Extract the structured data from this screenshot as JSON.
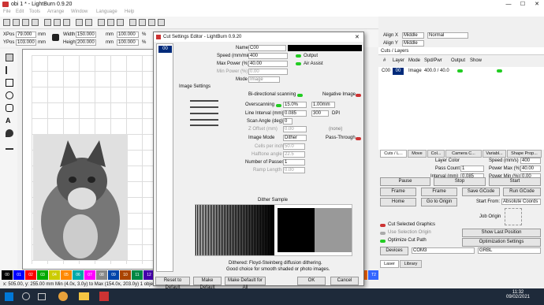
{
  "window": {
    "title": "obi 1 * - LightBurn 0.9.20"
  },
  "menu": [
    "File",
    "Edit",
    "Tools",
    "Arrange",
    "Window",
    "Language",
    "Help"
  ],
  "numbar": {
    "xpos_label": "XPos",
    "xpos": "79.000",
    "ypos_label": "YPos",
    "ypos": "103.000",
    "unit": "mm",
    "width_label": "Width",
    "width": "150.000",
    "height_label": "Height",
    "height": "200.000",
    "pct1": "100.000",
    "pct2": "100.000",
    "pct_sign": "%"
  },
  "top_right": {
    "align_x": "Align X",
    "middle": "Middle",
    "normal": "Normal",
    "align_y": "Align Y",
    "middle2": "Middle"
  },
  "dialog": {
    "title": "Cut Settings Editor - LightBurn 0.9.20",
    "layer_item": "00",
    "name_label": "Name",
    "name_value": "C00",
    "speed_label": "Speed (mm/min)",
    "speed": "400",
    "output_label": "Output",
    "maxpower_label": "Max Power (%)",
    "maxpower": "40.00",
    "airassist_label": "Air Assist",
    "minpower_label": "Min Power (%)",
    "minpower": "0.00",
    "mode_label": "Mode",
    "mode": "Image",
    "image_settings": "Image Settings",
    "bidir_label": "Bi-directional scanning",
    "negative_label": "Negative Image",
    "overscan_label": "Overscanning",
    "overscan_pct": "15.0%",
    "overscan_mm": "1.00mm",
    "line_interval_label": "Line Interval (mm)",
    "line_interval": "0.085",
    "dpi": "300",
    "dpi_label": "DPI",
    "scan_angle_label": "Scan Angle (deg)",
    "scan_angle": "0",
    "z_offset_label": "Z Offset (mm)",
    "z_offset": "0.00",
    "none": "(none)",
    "image_mode_label": "Image Mode",
    "image_mode": "Dither",
    "passthrough_label": "Pass-Through",
    "cells_label": "Cells per inch",
    "cells": "50.0",
    "halftone_label": "Halftone angle",
    "halftone": "22.5",
    "passes_label": "Number of Passes",
    "passes": "1",
    "ramp_label": "Ramp Length",
    "ramp": "0.00",
    "dither_sample": "Dither Sample",
    "desc1": "Dithered: Floyd-Steinberg diffusion dithering.",
    "desc2": "Good choice for smooth shaded or photo images.",
    "reset": "Reset to Default",
    "make_default": "Make Default",
    "make_default_all": "Make Default for All",
    "ok": "OK",
    "cancel": "Cancel"
  },
  "panel": {
    "title": "Cuts / Layers",
    "cols": [
      "#",
      "Layer",
      "Mode",
      "Spd/Pwr",
      "Output",
      "Show"
    ],
    "row": {
      "id": "C00",
      "layer": "00",
      "mode": "Image",
      "spdpwr": "400.0 / 40.0"
    },
    "tabs": [
      "Cuts / L...",
      "Move",
      "Col...",
      "Camera C...",
      "Variabl...",
      "Shape Prop..."
    ],
    "layer_color": "Layer Color",
    "speed_label": "Speed (mm/s)",
    "speed": "400",
    "pass_label": "Pass Count",
    "pass": "1",
    "pmax_label": "Power Max (%)",
    "pmax": "40.00",
    "interval_label": "Interval (mm)",
    "interval": "0.085",
    "pmin_label": "Power Min (%)",
    "pmin": "0.00",
    "pause": "Pause",
    "stop": "Stop",
    "start": "Start",
    "frame1": "Frame",
    "frame2": "Frame",
    "save_gcode": "Save GCode",
    "run_gcode": "Run GCode",
    "home": "Home",
    "go_origin": "Go to Origin",
    "start_from_label": "Start From:",
    "start_from": "Absolute Coords",
    "job_origin": "Job Origin",
    "cut_selected": "Cut Selected Graphics",
    "use_selection": "Use Selection Origin",
    "optimize": "Optimize Cut Path",
    "show_last": "Show Last Position",
    "opt_settings": "Optimization Settings",
    "devices": "Devices",
    "port": "COM3",
    "grbl": "GRBL",
    "tab_laser": "Laser",
    "tab_library": "Library"
  },
  "palette": [
    "00",
    "01",
    "02",
    "03",
    "04",
    "05",
    "06",
    "07",
    "08",
    "09",
    "10",
    "11",
    "12",
    "13",
    "14",
    "15",
    "16",
    "17",
    "18",
    "19",
    "20",
    "21",
    "22",
    "23",
    "24",
    "25",
    "26",
    "27",
    "28",
    "29",
    "T1",
    "T2"
  ],
  "palette_colors": [
    "#000000",
    "#0000ff",
    "#ff0000",
    "#00aa00",
    "#cccc00",
    "#ff8800",
    "#00aaaa",
    "#ff00ff",
    "#888888",
    "#0044aa",
    "#aa4400",
    "#008844",
    "#4400aa",
    "#aa0044",
    "#666600",
    "#006666",
    "#660066",
    "#aa6600",
    "#0066aa",
    "#66aa00",
    "#aa0066",
    "#00aa66",
    "#6600aa",
    "#888800",
    "#008888",
    "#880088",
    "#444444",
    "#aa8844",
    "#4488aa",
    "#88aa44",
    "#ff6600",
    "#3366ff"
  ],
  "status": "x: 505.00, y: 255.00 mm   Min (4.0x, 3.0y) to Max (154.0x, 203.0y)  1 objects",
  "taskbar": {
    "time": "11:32",
    "date": "09/02/2021"
  }
}
